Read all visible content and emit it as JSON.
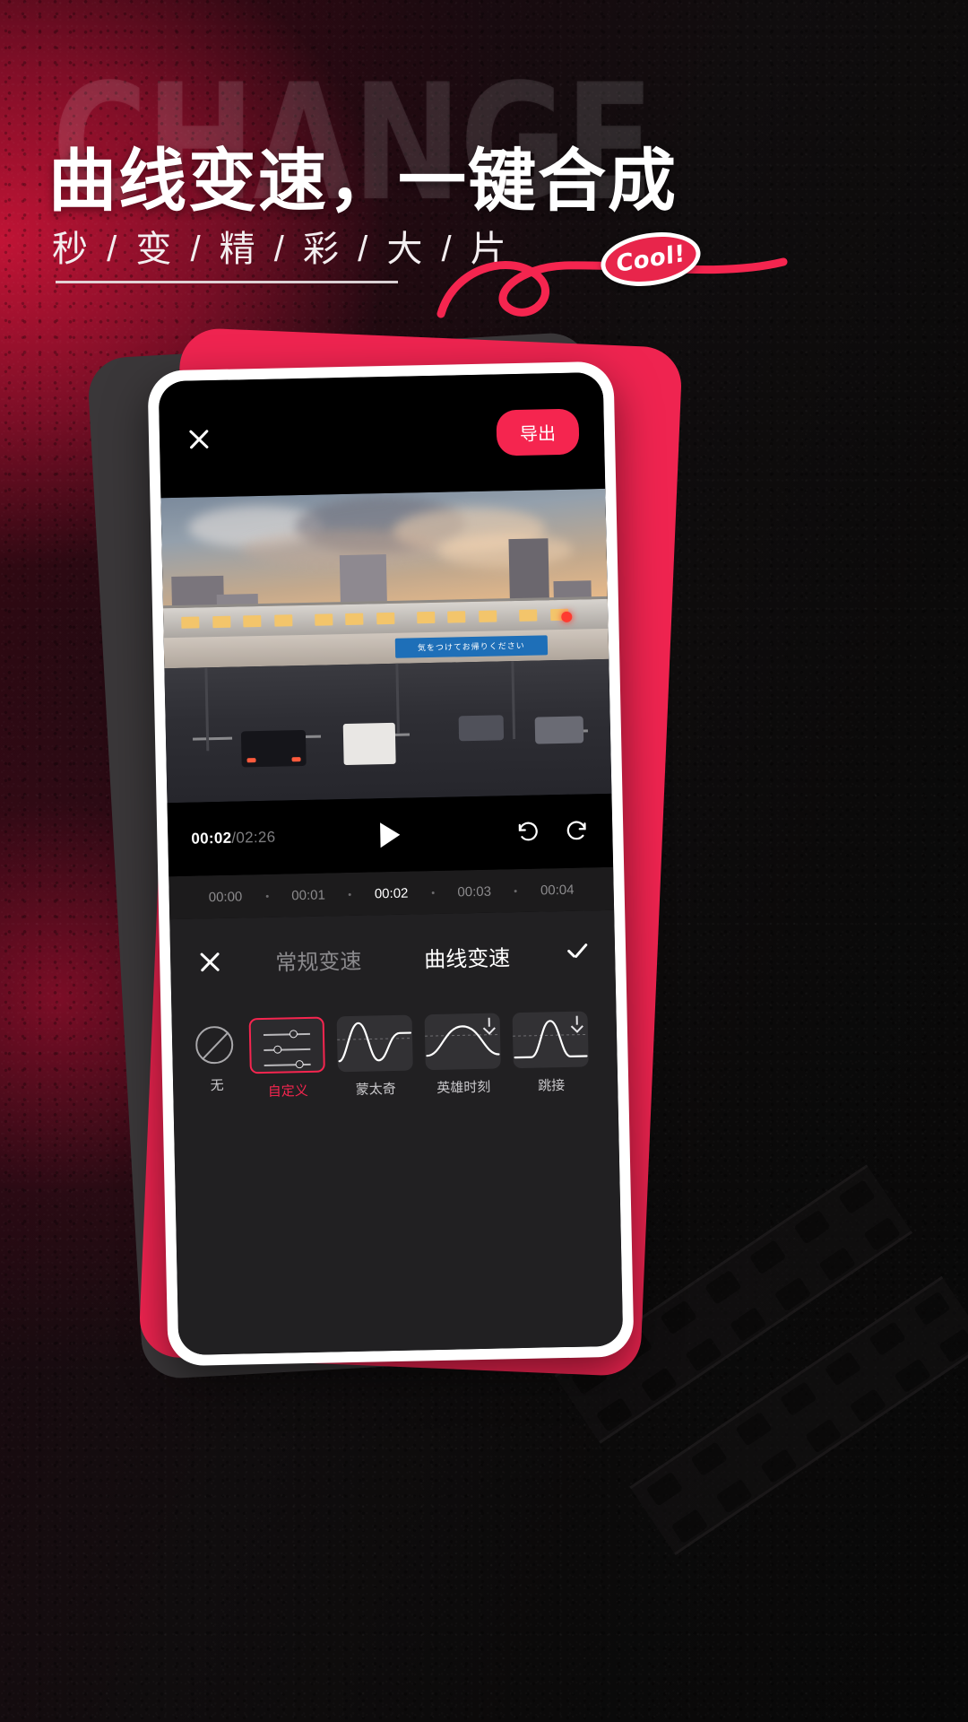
{
  "poster": {
    "ghost_word": "CHANGE",
    "headline": "曲线变速，一键合成",
    "subheadline": "秒 / 变 / 精 / 彩 / 大 / 片",
    "badge_text": "Cool!",
    "accent_color": "#f5254f",
    "accent_dark": "#c4143c"
  },
  "app": {
    "topbar": {
      "close_icon": "close-icon",
      "export_label": "导出"
    },
    "player": {
      "current_time": "00:02",
      "separator": "/",
      "total_time": "02:26",
      "play_icon": "play-icon",
      "undo_icon": "undo-icon",
      "redo_icon": "redo-icon"
    },
    "ruler": {
      "ticks": [
        "00:00",
        "00:01",
        "00:02",
        "00:03",
        "00:04"
      ],
      "current_index": 2
    },
    "speed_panel": {
      "close_icon": "close-icon",
      "confirm_icon": "check-icon",
      "tabs": [
        {
          "label": "常规变速",
          "active": false
        },
        {
          "label": "曲线变速",
          "active": true
        }
      ],
      "presets": [
        {
          "label": "无",
          "kind": "none",
          "selected": false,
          "downloadable": false
        },
        {
          "label": "自定义",
          "kind": "custom",
          "selected": true,
          "downloadable": false
        },
        {
          "label": "蒙太奇",
          "kind": "montage",
          "selected": false,
          "downloadable": false
        },
        {
          "label": "英雄时刻",
          "kind": "hero",
          "selected": false,
          "downloadable": true
        },
        {
          "label": "跳接",
          "kind": "jumpcut",
          "selected": false,
          "downloadable": true
        }
      ]
    },
    "preview": {
      "sign_text": "気をつけてお帰りください"
    }
  }
}
